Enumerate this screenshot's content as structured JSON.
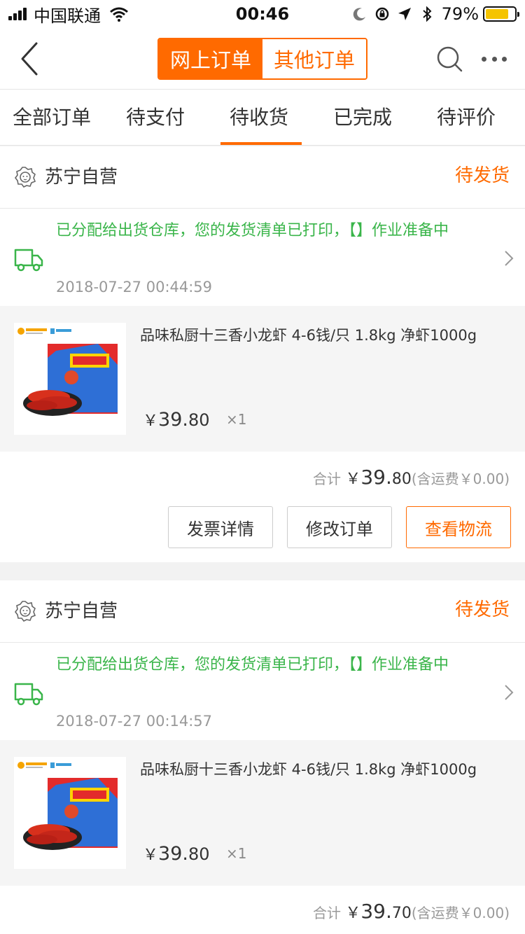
{
  "status_bar": {
    "carrier": "中国联通",
    "time": "00:46",
    "battery_pct": "79%",
    "battery_level": 0.79,
    "battery_color": "#f5c400"
  },
  "nav": {
    "back_icon": "chevron-left-icon",
    "segment_active": "网上订单",
    "segment_inactive": "其他订单",
    "search_icon": "search-icon",
    "more_icon": "more-dots-icon"
  },
  "tabs": [
    {
      "label": "全部订单"
    },
    {
      "label": "待支付"
    },
    {
      "label": "待收货",
      "active": true
    },
    {
      "label": "已完成"
    },
    {
      "label": "待评价"
    }
  ],
  "colors": {
    "accent": "#ff6a00",
    "logistics_green": "#3ab54a"
  },
  "orders": [
    {
      "shop_name": "苏宁自营",
      "status": "待发货",
      "logistics_msg": "已分配给出货仓库，您的发货清单已打印，【】作业准备中",
      "logistics_time": "2018-07-27 00:44:59",
      "product_name": "品味私厨十三香小龙虾 4-6钱/只 1.8kg 净虾1000g",
      "price_symbol": "￥",
      "price_int": "39.",
      "price_dec": "80",
      "qty": "×1",
      "total_label": "合计",
      "total_symbol": "￥",
      "total_int": "39.",
      "total_dec": "80",
      "shipping": "(含运费￥0.00)",
      "buttons": [
        "发票详情",
        "修改订单",
        "查看物流"
      ]
    },
    {
      "shop_name": "苏宁自营",
      "status": "待发货",
      "logistics_msg": "已分配给出货仓库，您的发货清单已打印，【】作业准备中",
      "logistics_time": "2018-07-27 00:14:57",
      "product_name": "品味私厨十三香小龙虾 4-6钱/只 1.8kg 净虾1000g",
      "price_symbol": "￥",
      "price_int": "39.",
      "price_dec": "80",
      "qty": "×1",
      "total_label": "合计",
      "total_symbol": "￥",
      "total_int": "39.",
      "total_dec": "70",
      "shipping": "(含运费￥0.00)"
    }
  ]
}
